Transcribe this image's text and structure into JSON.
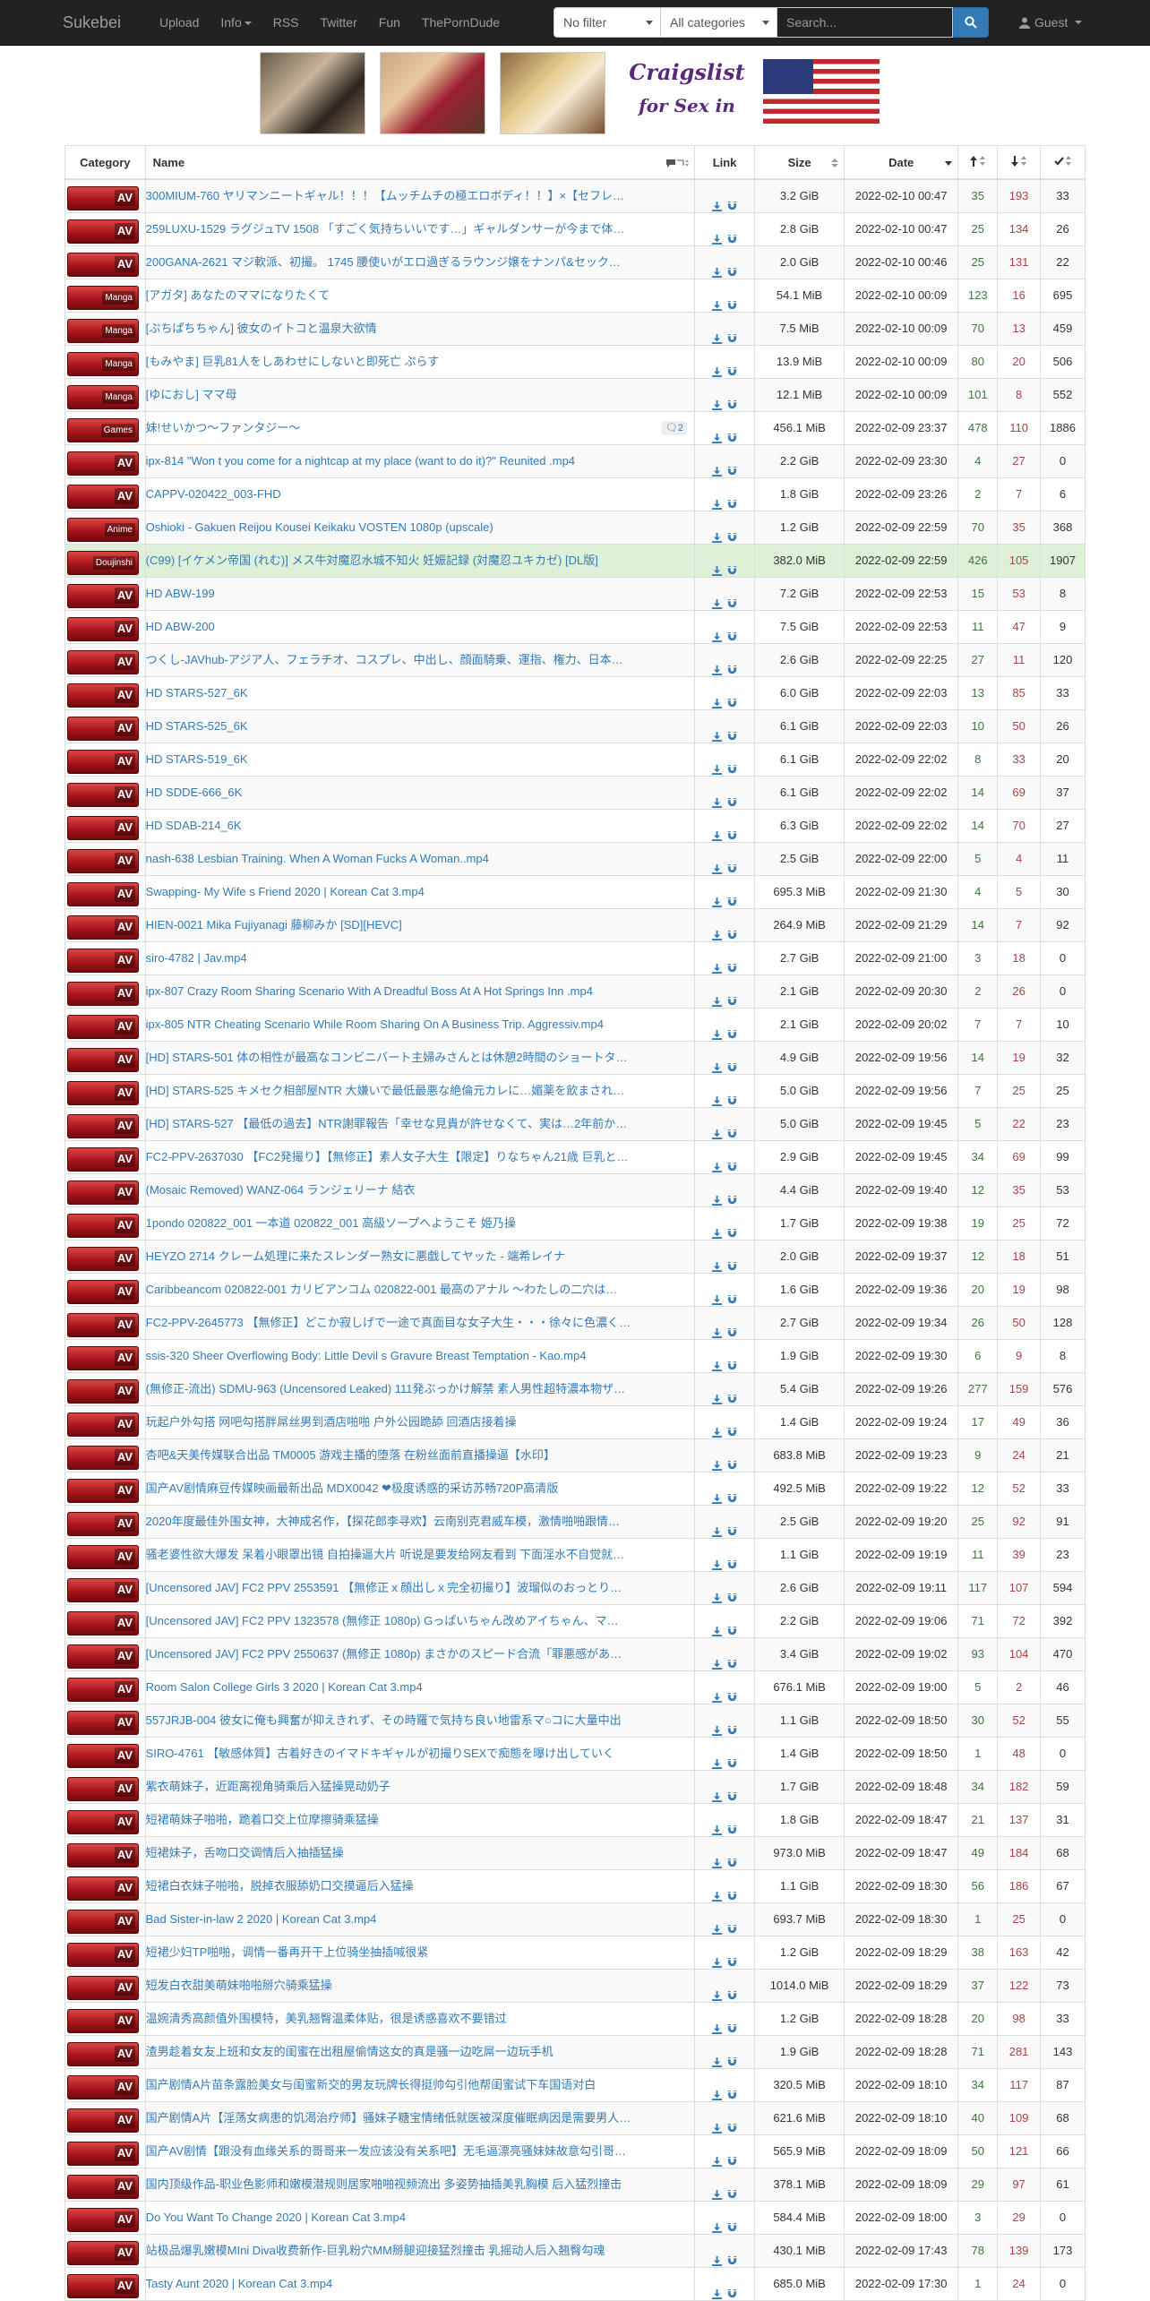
{
  "nav": {
    "brand": "Sukebei",
    "links": [
      "Upload",
      "Info",
      "RSS",
      "Twitter",
      "Fun",
      "ThePornDude"
    ],
    "filter": "No filter",
    "category": "All categories",
    "search_placeholder": "Search...",
    "user": "Guest"
  },
  "banner": {
    "title_line1": "Craigslist",
    "title_line2": "for Sex in"
  },
  "table": {
    "headers": {
      "category": "Category",
      "name": "Name",
      "link": "Link",
      "size": "Size",
      "date": "Date"
    },
    "rows": [
      {
        "cat": "AV",
        "name": "300MIUM-760 ヤリマンニートギャル！！！【ムッチムチの極エロボディ！！】×【セフレ…",
        "size": "3.2 GiB",
        "date": "2022-02-10 00:47",
        "se": "35",
        "le": "193",
        "dl": "33"
      },
      {
        "cat": "AV",
        "name": "259LUXU-1529 ラグジュTV 1508 「すごく気持ちいいです…」ギャルダンサーが今まで体…",
        "size": "2.8 GiB",
        "date": "2022-02-10 00:47",
        "se": "25",
        "le": "134",
        "dl": "26"
      },
      {
        "cat": "AV",
        "name": "200GANA-2621 マジ軟派、初撮。 1745 腰使いがエロ過ぎるラウンジ嬢をナンパ&セック…",
        "size": "2.0 GiB",
        "date": "2022-02-10 00:46",
        "se": "25",
        "le": "131",
        "dl": "22"
      },
      {
        "cat": "Manga",
        "name": "[アガタ] あなたのママになりたくて",
        "size": "54.1 MiB",
        "date": "2022-02-10 00:09",
        "se": "123",
        "le": "16",
        "dl": "695"
      },
      {
        "cat": "Manga",
        "name": "[ぷちぱちちゃん] 彼女のイトコと温泉大欲情",
        "size": "7.5 MiB",
        "date": "2022-02-10 00:09",
        "se": "70",
        "le": "13",
        "dl": "459"
      },
      {
        "cat": "Manga",
        "name": "[もみやま] 巨乳81人をしあわせにしないと即死亡 ぷらす",
        "size": "13.9 MiB",
        "date": "2022-02-10 00:09",
        "se": "80",
        "le": "20",
        "dl": "506"
      },
      {
        "cat": "Manga",
        "name": "[ゆにおし] ママ母",
        "size": "12.1 MiB",
        "date": "2022-02-10 00:09",
        "se": "101",
        "le": "8",
        "dl": "552"
      },
      {
        "cat": "Games",
        "name": "妹!せいかつ～ファンタジー～",
        "comments": "2",
        "size": "456.1 MiB",
        "date": "2022-02-09 23:37",
        "se": "478",
        "le": "110",
        "dl": "1886"
      },
      {
        "cat": "AV",
        "name": "ipx-814 \"Won t you come for a nightcap at my place (want to do it)?\" Reunited .mp4",
        "size": "2.2 GiB",
        "date": "2022-02-09 23:30",
        "se": "4",
        "le": "27",
        "dl": "0"
      },
      {
        "cat": "AV",
        "name": "CAPPV-020422_003-FHD",
        "size": "1.8 GiB",
        "date": "2022-02-09 23:26",
        "se": "2",
        "le": "7",
        "dl": "6"
      },
      {
        "cat": "Anime",
        "name": "Oshioki - Gakuen Reijou Kousei Keikaku VOSTEN 1080p (upscale)",
        "size": "1.2 GiB",
        "date": "2022-02-09 22:59",
        "se": "70",
        "le": "35",
        "dl": "368"
      },
      {
        "cat": "Doujinshi",
        "name": "(C99) [イケメン帝国 (れむ)] メス牛対魔忍水城不知火 妊娠記録 (対魔忍ユキカゼ) [DL版]",
        "size": "382.0 MiB",
        "date": "2022-02-09 22:59",
        "se": "426",
        "le": "105",
        "dl": "1907",
        "trusted": true
      },
      {
        "cat": "AV",
        "name": "HD ABW-199",
        "size": "7.2 GiB",
        "date": "2022-02-09 22:53",
        "se": "15",
        "le": "53",
        "dl": "8"
      },
      {
        "cat": "AV",
        "name": "HD ABW-200",
        "size": "7.5 GiB",
        "date": "2022-02-09 22:53",
        "se": "11",
        "le": "47",
        "dl": "9"
      },
      {
        "cat": "AV",
        "name": "つくし-JAVhub-アジア人、フェラチオ、コスプレ、中出し、顔面騎乗、運指、権力、日本…",
        "size": "2.6 GiB",
        "date": "2022-02-09 22:25",
        "se": "27",
        "le": "11",
        "dl": "120"
      },
      {
        "cat": "AV",
        "name": "HD STARS-527_6K",
        "size": "6.0 GiB",
        "date": "2022-02-09 22:03",
        "se": "13",
        "le": "85",
        "dl": "33"
      },
      {
        "cat": "AV",
        "name": "HD STARS-525_6K",
        "size": "6.1 GiB",
        "date": "2022-02-09 22:03",
        "se": "10",
        "le": "50",
        "dl": "26"
      },
      {
        "cat": "AV",
        "name": "HD STARS-519_6K",
        "size": "6.1 GiB",
        "date": "2022-02-09 22:02",
        "se": "8",
        "le": "33",
        "dl": "20"
      },
      {
        "cat": "AV",
        "name": "HD SDDE-666_6K",
        "size": "6.1 GiB",
        "date": "2022-02-09 22:02",
        "se": "14",
        "le": "69",
        "dl": "37"
      },
      {
        "cat": "AV",
        "name": "HD SDAB-214_6K",
        "size": "6.3 GiB",
        "date": "2022-02-09 22:02",
        "se": "14",
        "le": "70",
        "dl": "27"
      },
      {
        "cat": "AV",
        "name": "nash-638 Lesbian Training. When A Woman Fucks A Woman..mp4",
        "size": "2.5 GiB",
        "date": "2022-02-09 22:00",
        "se": "5",
        "le": "4",
        "dl": "11"
      },
      {
        "cat": "AV",
        "name": "Swapping- My Wife s Friend 2020 | Korean Cat 3.mp4",
        "size": "695.3 MiB",
        "date": "2022-02-09 21:30",
        "se": "4",
        "le": "5",
        "dl": "30"
      },
      {
        "cat": "AV",
        "name": "HIEN-0021 Mika Fujiyanagi 藤柳みか [SD][HEVC]",
        "size": "264.9 MiB",
        "date": "2022-02-09 21:29",
        "se": "14",
        "le": "7",
        "dl": "92"
      },
      {
        "cat": "AV",
        "name": "siro-4782 | Jav.mp4",
        "size": "2.7 GiB",
        "date": "2022-02-09 21:00",
        "se": "3",
        "le": "18",
        "dl": "0"
      },
      {
        "cat": "AV",
        "name": "ipx-807 Crazy Room Sharing Scenario With A Dreadful Boss At A Hot Springs Inn .mp4",
        "size": "2.1 GiB",
        "date": "2022-02-09 20:30",
        "se": "2",
        "le": "26",
        "dl": "0"
      },
      {
        "cat": "AV",
        "name": "ipx-805 NTR Cheating Scenario While Room Sharing On A Business Trip. Aggressiv.mp4",
        "size": "2.1 GiB",
        "date": "2022-02-09 20:02",
        "se": "7",
        "le": "7",
        "dl": "10"
      },
      {
        "cat": "AV",
        "name": "[HD] STARS-501 体の相性が最高なコンビニバート主婦みさんとは休憩2時間のショートタ…",
        "size": "4.9 GiB",
        "date": "2022-02-09 19:56",
        "se": "14",
        "le": "19",
        "dl": "32"
      },
      {
        "cat": "AV",
        "name": "[HD] STARS-525 キメセク相部屋NTR 大嫌いで最低最悪な絶倫元カレに…媚薬を飲まされ…",
        "size": "5.0 GiB",
        "date": "2022-02-09 19:56",
        "se": "7",
        "le": "25",
        "dl": "25"
      },
      {
        "cat": "AV",
        "name": "[HD] STARS-527 【最低の過去】NTR謝罪報告「幸せな見貴が許せなくて、実は…2年前か…",
        "size": "5.0 GiB",
        "date": "2022-02-09 19:45",
        "se": "5",
        "le": "22",
        "dl": "23"
      },
      {
        "cat": "AV",
        "name": "FC2-PPV-2637030 【FC2発撮り】【無修正】素人女子大生【限定】りなちゃん21歳 巨乳と…",
        "size": "2.9 GiB",
        "date": "2022-02-09 19:45",
        "se": "34",
        "le": "69",
        "dl": "99"
      },
      {
        "cat": "AV",
        "name": "(Mosaic Removed) WANZ-064 ランジェリーナ 結衣",
        "size": "4.4 GiB",
        "date": "2022-02-09 19:40",
        "se": "12",
        "le": "35",
        "dl": "53"
      },
      {
        "cat": "AV",
        "name": "1pondo 020822_001 一本道 020822_001 高級ソープへようこそ 姫乃操",
        "size": "1.7 GiB",
        "date": "2022-02-09 19:38",
        "se": "19",
        "le": "25",
        "dl": "72"
      },
      {
        "cat": "AV",
        "name": "HEYZO 2714 クレーム処理に来たスレンダー熟女に悪戯してヤッた - 端希レイナ",
        "size": "2.0 GiB",
        "date": "2022-02-09 19:37",
        "se": "12",
        "le": "18",
        "dl": "51"
      },
      {
        "cat": "AV",
        "name": "Caribbeancom 020822-001 カリビアンコム 020822-001 最高のアナル ～わたしの二穴は…",
        "size": "1.6 GiB",
        "date": "2022-02-09 19:36",
        "se": "20",
        "le": "19",
        "dl": "98"
      },
      {
        "cat": "AV",
        "name": "FC2-PPV-2645773 【無修正】どこか寂しげで一途で真面目な女子大生・・・徐々に色濃く…",
        "size": "2.7 GiB",
        "date": "2022-02-09 19:34",
        "se": "26",
        "le": "50",
        "dl": "128"
      },
      {
        "cat": "AV",
        "name": "ssis-320 Sheer Overflowing Body: Little Devil s Gravure Breast Temptation - Kao.mp4",
        "size": "1.9 GiB",
        "date": "2022-02-09 19:30",
        "se": "6",
        "le": "9",
        "dl": "8"
      },
      {
        "cat": "AV",
        "name": "(無修正-流出) SDMU-963 (Uncensored Leaked) 111発ぶっかけ解禁 素人男性超特濃本物ザ…",
        "size": "5.4 GiB",
        "date": "2022-02-09 19:26",
        "se": "277",
        "le": "159",
        "dl": "576"
      },
      {
        "cat": "AV",
        "name": "玩起户外勾搭 网吧勾搭胖屌丝男到酒店啪啪 户外公园跪舔 回酒店接着操",
        "size": "1.4 GiB",
        "date": "2022-02-09 19:24",
        "se": "17",
        "le": "49",
        "dl": "36"
      },
      {
        "cat": "AV",
        "name": "杏吧&天美传媒联合出品 TM0005 游戏主播的堕落 在粉丝面前直播操逼【水印】",
        "size": "683.8 MiB",
        "date": "2022-02-09 19:23",
        "se": "9",
        "le": "24",
        "dl": "21"
      },
      {
        "cat": "AV",
        "name": "国产AV剧情麻豆传媒映画最新出品 MDX0042 ❤极度诱惑的采访苏畅720P高清版",
        "size": "492.5 MiB",
        "date": "2022-02-09 19:22",
        "se": "12",
        "le": "52",
        "dl": "33"
      },
      {
        "cat": "AV",
        "name": "2020年度最佳外围女神，大神成名作，【探花郎李寻欢】云南别克君威车模，激情啪啪跟情…",
        "size": "2.5 GiB",
        "date": "2022-02-09 19:20",
        "se": "25",
        "le": "92",
        "dl": "91"
      },
      {
        "cat": "AV",
        "name": "骚老婆性欲大爆发 呆着小眼罩出镜 自拍操逼大片 听说是要发给网友看到 下面淫水不自觉就…",
        "size": "1.1 GiB",
        "date": "2022-02-09 19:19",
        "se": "11",
        "le": "39",
        "dl": "23"
      },
      {
        "cat": "AV",
        "name": "[Uncensored JAV] FC2 PPV 2553591 【無修正ｘ顔出しｘ完全初撮り】波瑠似のおっとり…",
        "size": "2.6 GiB",
        "date": "2022-02-09 19:11",
        "se": "117",
        "le": "107",
        "dl": "594"
      },
      {
        "cat": "AV",
        "name": "[Uncensored JAV] FC2 PPV 1323578 (無修正 1080p) Gっぱいちゃん改めアイちゃん、マ…",
        "size": "2.2 GiB",
        "date": "2022-02-09 19:06",
        "se": "71",
        "le": "72",
        "dl": "392"
      },
      {
        "cat": "AV",
        "name": "[Uncensored JAV] FC2 PPV 2550637 (無修正 1080p) まさかのスピード合流「罪悪感があ…",
        "size": "3.4 GiB",
        "date": "2022-02-09 19:02",
        "se": "93",
        "le": "104",
        "dl": "470"
      },
      {
        "cat": "AV",
        "name": "Room Salon College Girls 3 2020 | Korean Cat 3.mp4",
        "size": "676.1 MiB",
        "date": "2022-02-09 19:00",
        "se": "5",
        "le": "2",
        "dl": "46"
      },
      {
        "cat": "AV",
        "name": "557JRJB-004 彼女に俺も興奮が抑えきれず、その時羅で気持ち良い地雷系マ○コに大量中出",
        "size": "1.1 GiB",
        "date": "2022-02-09 18:50",
        "se": "30",
        "le": "52",
        "dl": "55"
      },
      {
        "cat": "AV",
        "name": "SIRO-4761 【敏感体質】古着好きのイマドキギャルが初撮りSEXで痴態を曝け出していく",
        "size": "1.4 GiB",
        "date": "2022-02-09 18:50",
        "se": "1",
        "le": "48",
        "dl": "0"
      },
      {
        "cat": "AV",
        "name": "紫衣萌妹子，近距离视角骑乘后入猛操晃动奶子",
        "size": "1.7 GiB",
        "date": "2022-02-09 18:48",
        "se": "34",
        "le": "182",
        "dl": "59"
      },
      {
        "cat": "AV",
        "name": "短裙萌妹子啪啪，跪着口交上位摩擦骑乘猛操",
        "size": "1.8 GiB",
        "date": "2022-02-09 18:47",
        "se": "21",
        "le": "137",
        "dl": "31"
      },
      {
        "cat": "AV",
        "name": "短裙妹子，舌吻口交调情后入抽插猛操",
        "size": "973.0 MiB",
        "date": "2022-02-09 18:47",
        "se": "49",
        "le": "184",
        "dl": "68"
      },
      {
        "cat": "AV",
        "name": "短裙白衣妹子啪啪，脱掉衣服舔奶口交摸逼后入猛操",
        "size": "1.1 GiB",
        "date": "2022-02-09 18:30",
        "se": "56",
        "le": "186",
        "dl": "67"
      },
      {
        "cat": "AV",
        "name": "Bad Sister-in-law 2 2020 | Korean Cat 3.mp4",
        "size": "693.7 MiB",
        "date": "2022-02-09 18:30",
        "se": "1",
        "le": "25",
        "dl": "0"
      },
      {
        "cat": "AV",
        "name": "短裙少妇TP啪啪，调情一番再开干上位骑坐抽插喊很紧",
        "size": "1.2 GiB",
        "date": "2022-02-09 18:29",
        "se": "38",
        "le": "163",
        "dl": "42"
      },
      {
        "cat": "AV",
        "name": "短发白衣甜美萌妹啪啪掰穴骑乘猛操",
        "size": "1014.0 MiB",
        "date": "2022-02-09 18:29",
        "se": "37",
        "le": "122",
        "dl": "73"
      },
      {
        "cat": "AV",
        "name": "温婉清秀高颜值外围模特，美乳翘臀温柔体贴，很是诱惑喜欢不要错过",
        "size": "1.2 GiB",
        "date": "2022-02-09 18:28",
        "se": "20",
        "le": "98",
        "dl": "33"
      },
      {
        "cat": "AV",
        "name": "渣男趁着女友上班和女友的闺蜜在出租屋偷情这女的真是骚一边吃屌一边玩手机",
        "size": "1.9 GiB",
        "date": "2022-02-09 18:28",
        "se": "71",
        "le": "281",
        "dl": "143"
      },
      {
        "cat": "AV",
        "name": "国产剧情A片苗条露脸美女与闺蜜新交的男友玩牌长得挺帅勾引他帮闺蜜试下车国语对白",
        "size": "320.5 MiB",
        "date": "2022-02-09 18:10",
        "se": "34",
        "le": "117",
        "dl": "87"
      },
      {
        "cat": "AV",
        "name": "国产剧情A片【淫荡女病患的饥渴治疗师】骚妹子糖宝情绪低就医被深度催眠病因是需要男人…",
        "size": "621.6 MiB",
        "date": "2022-02-09 18:10",
        "se": "40",
        "le": "109",
        "dl": "68"
      },
      {
        "cat": "AV",
        "name": "国产AV剧情【跟没有血缘关系的哥哥来一发应该没有关系吧】无毛逼漂亮骚妹妹故意勾引哥…",
        "size": "565.9 MiB",
        "date": "2022-02-09 18:09",
        "se": "50",
        "le": "121",
        "dl": "66"
      },
      {
        "cat": "AV",
        "name": "国内顶级作品-职业色影师和嫩模潜规则居家啪啪视频流出 多姿势抽插美乳胸模 后入猛烈撞击",
        "size": "378.1 MiB",
        "date": "2022-02-09 18:09",
        "se": "29",
        "le": "97",
        "dl": "61"
      },
      {
        "cat": "AV",
        "name": "Do You Want To Change 2020 | Korean Cat 3.mp4",
        "size": "584.4 MiB",
        "date": "2022-02-09 18:00",
        "se": "3",
        "le": "29",
        "dl": "0"
      },
      {
        "cat": "AV",
        "name": "站极品爆乳嫩模MIni Diva收费新作-巨乳粉穴MM掰腿迎接猛烈撞击 乳摇动人后入翘臀勾魂",
        "size": "430.1 MiB",
        "date": "2022-02-09 17:43",
        "se": "78",
        "le": "139",
        "dl": "173"
      },
      {
        "cat": "AV",
        "name": "Tasty Aunt 2020 | Korean Cat 3.mp4",
        "size": "685.0 MiB",
        "date": "2022-02-09 17:30",
        "se": "1",
        "le": "24",
        "dl": "0"
      }
    ]
  },
  "colors": {
    "navbar_bg": "#222222",
    "link": "#337ab7",
    "seeders": "#3c763d",
    "leechers": "#a94442",
    "trusted_row": "#dff0d8"
  },
  "icons": [
    "search-icon",
    "user-icon",
    "comments-icon",
    "download-icon",
    "magnet-icon",
    "sort-icon",
    "arrow-up-icon",
    "arrow-down-icon",
    "check-icon"
  ]
}
